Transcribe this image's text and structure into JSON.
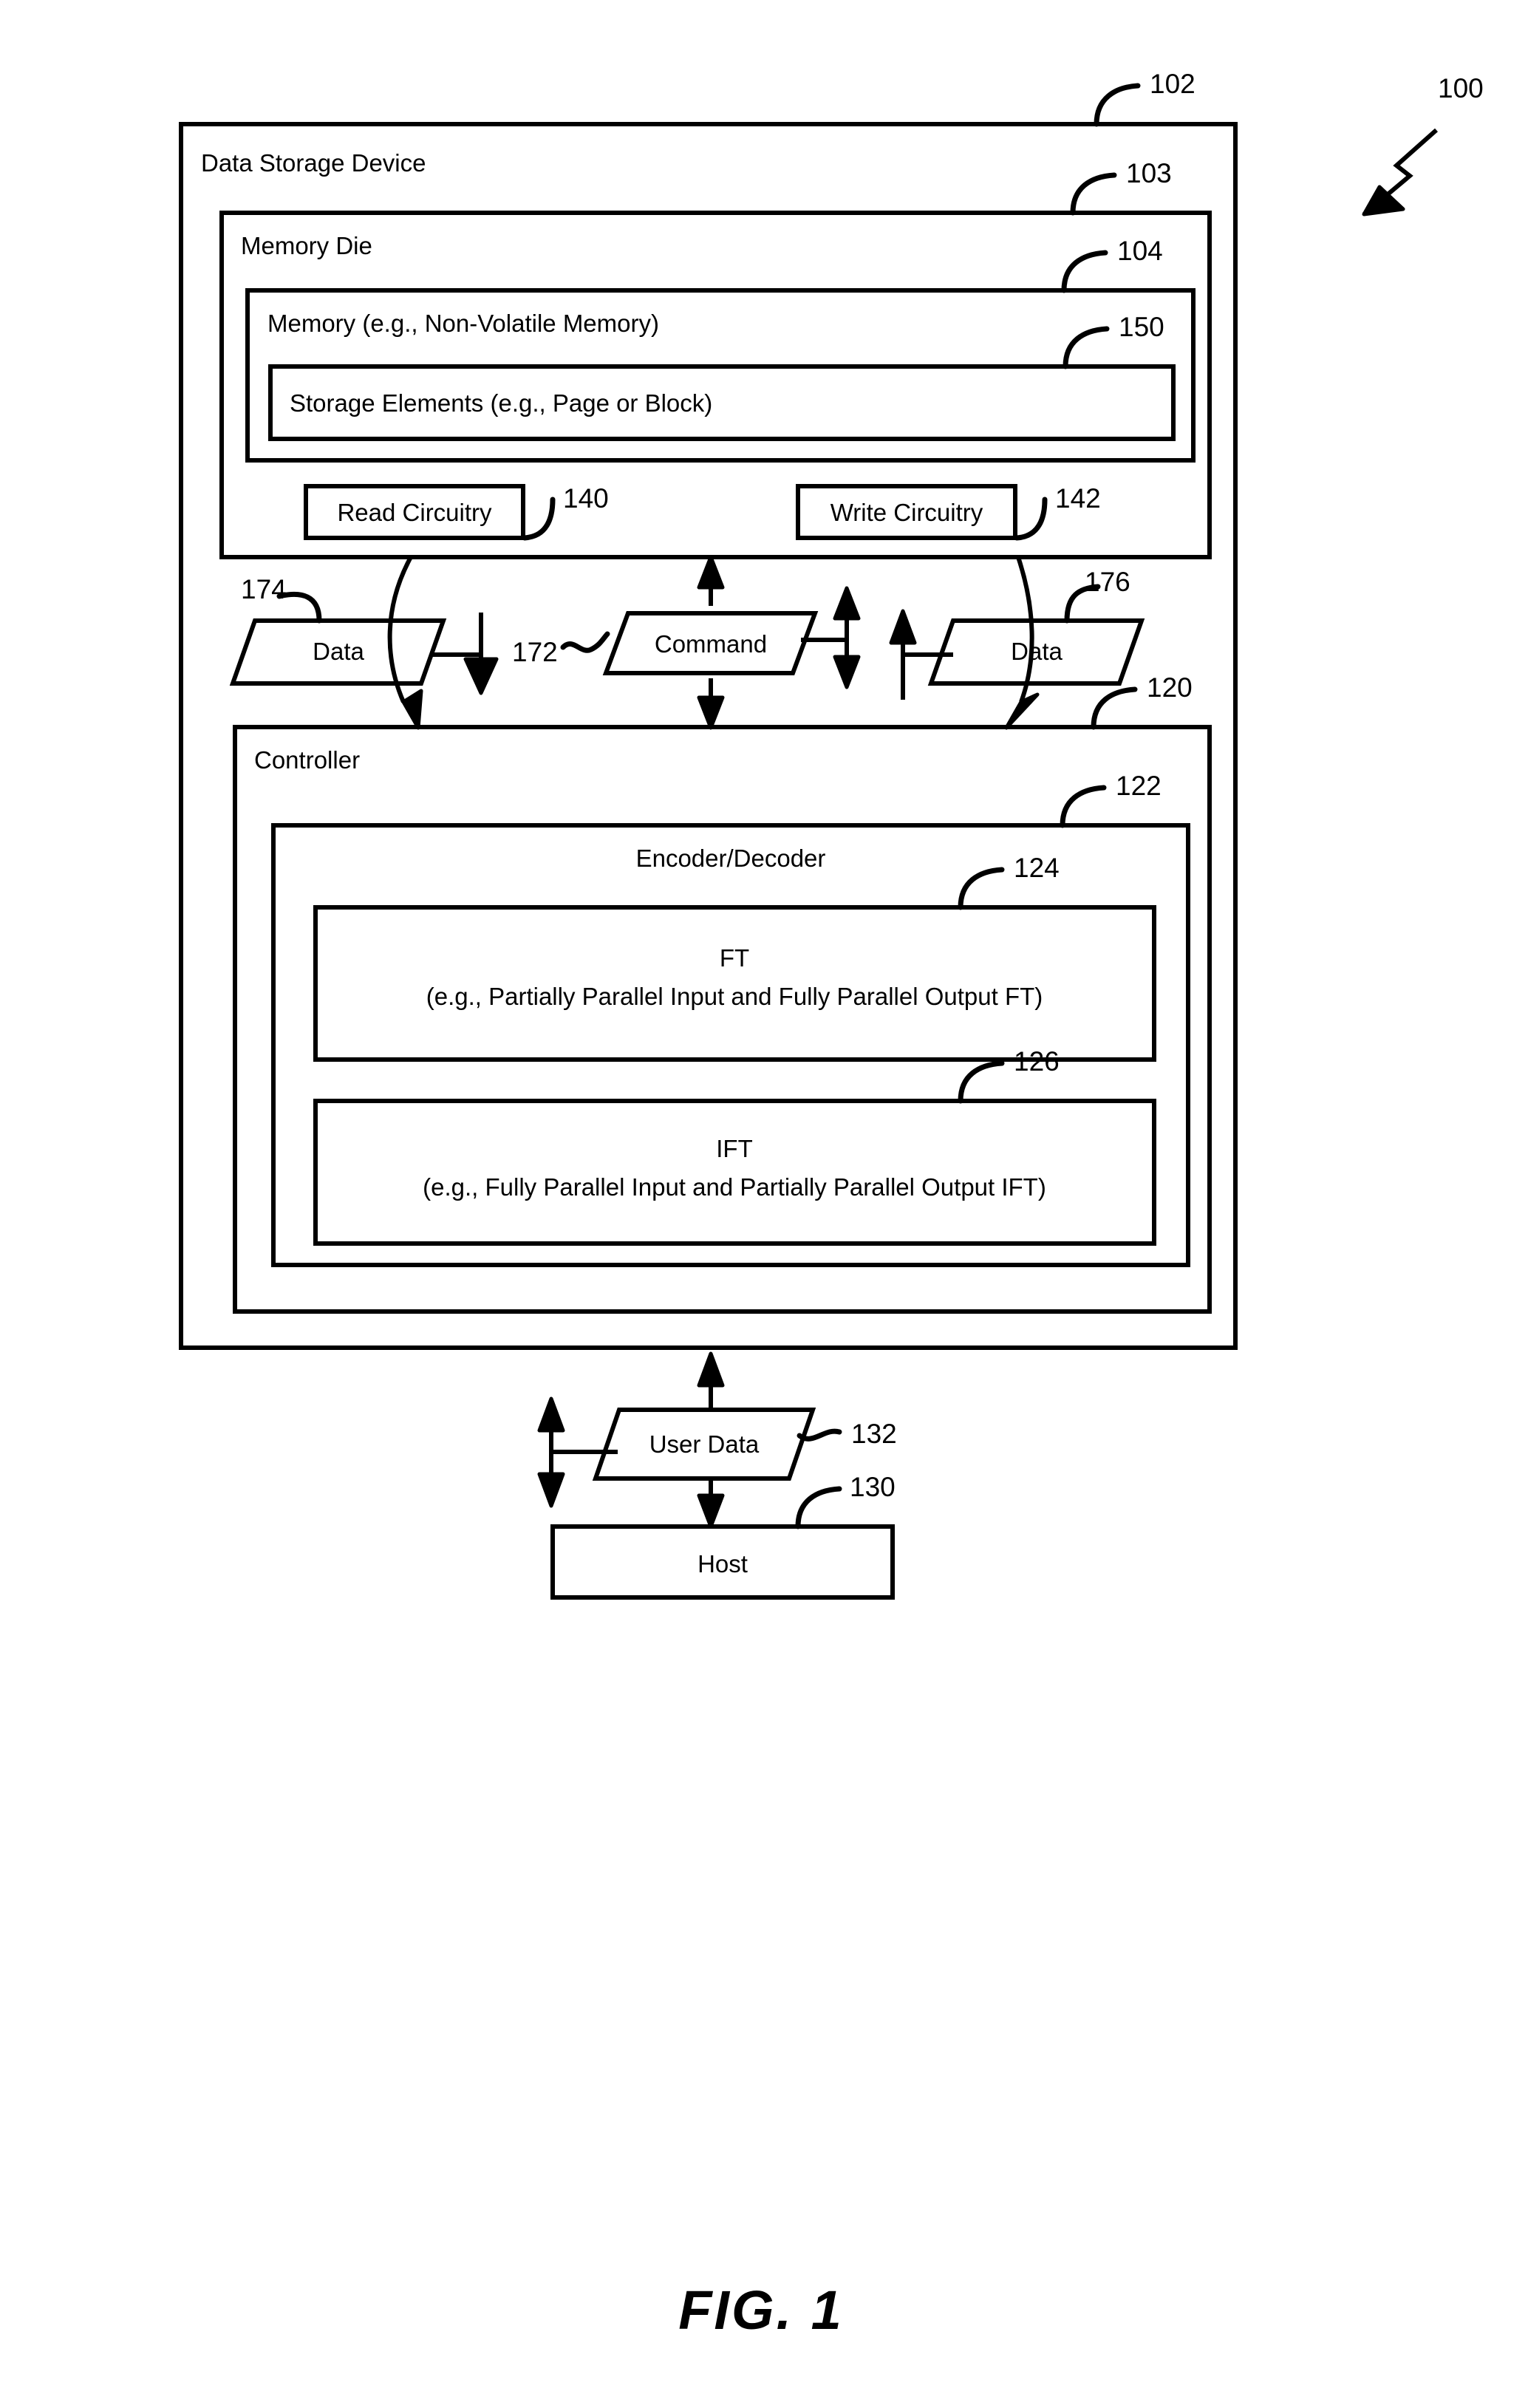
{
  "figure": {
    "caption": "FIG. 1",
    "system_ref": "100"
  },
  "blocks": {
    "data_storage_device": {
      "label": "Data Storage Device",
      "ref": "102"
    },
    "memory_die": {
      "label": "Memory Die",
      "ref": "103"
    },
    "memory": {
      "label": "Memory (e.g., Non-Volatile Memory)",
      "ref": "104"
    },
    "storage_elements": {
      "label": "Storage Elements (e.g., Page or Block)",
      "ref": "150"
    },
    "read_circuitry": {
      "label": "Read Circuitry",
      "ref": "140"
    },
    "write_circuitry": {
      "label": "Write Circuitry",
      "ref": "142"
    },
    "controller": {
      "label": "Controller",
      "ref": "120"
    },
    "encoder_decoder": {
      "label": "Encoder/Decoder",
      "ref": "122"
    },
    "ft": {
      "label_line1": "FT",
      "label_line2": "(e.g., Partially Parallel Input and Fully Parallel Output FT)",
      "ref": "124"
    },
    "ift": {
      "label_line1": "IFT",
      "label_line2": "(e.g., Fully Parallel Input and Partially Parallel Output IFT)",
      "ref": "126"
    },
    "host": {
      "label": "Host",
      "ref": "130"
    }
  },
  "flows": {
    "data_left": {
      "label": "Data",
      "ref": "174"
    },
    "command": {
      "label": "Command",
      "ref": "172"
    },
    "data_right": {
      "label": "Data",
      "ref": "176"
    },
    "user_data": {
      "label": "User Data",
      "ref": "132"
    }
  },
  "style": {
    "ink": "#000000",
    "paper": "#ffffff"
  }
}
